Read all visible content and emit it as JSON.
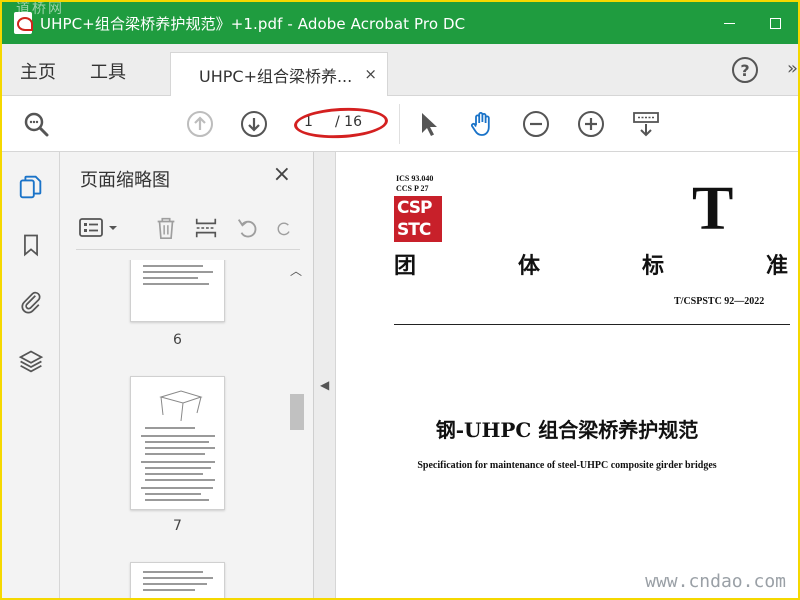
{
  "window": {
    "title": "UHPC+组合梁桥养护规范》+1.pdf - Adobe Acrobat Pro DC",
    "watermark_top": "道桥网"
  },
  "menu": {
    "home_label": "主页",
    "tools_label": "工具",
    "doc_tab_label": "UHPC+组合梁桥养...",
    "doc_tab_close": "×",
    "help_label": "?",
    "more_label": "»"
  },
  "toolbar": {
    "current_page": "1",
    "total_pages": "/ 16",
    "icons": [
      "search-icon",
      "page-up-icon",
      "page-down-icon",
      "select-arrow-icon",
      "hand-tool-icon",
      "zoom-out-icon",
      "zoom-in-icon",
      "keyboard-scroll-icon"
    ],
    "accent_color": "#1a73c8",
    "highlight_color": "#d42020"
  },
  "sidebar": {
    "icons": [
      "page-thumbnails-icon",
      "bookmarks-icon",
      "attachments-icon",
      "layers-icon"
    ]
  },
  "thumb_panel": {
    "title": "页面缩略图",
    "close_label": "×",
    "tools": [
      "options-menu-icon",
      "delete-icon",
      "insert-page-icon",
      "rotate-left-icon",
      "rotate-right-icon"
    ],
    "pages": [
      {
        "number": "6"
      },
      {
        "number": "7"
      }
    ]
  },
  "document": {
    "ics": "ICS  93.040",
    "ccs": "CCS  P  27",
    "logo_top": "CSP",
    "logo_bottom": "STC",
    "big_letter": "T",
    "group_standard_chars": [
      "团",
      "体",
      "标",
      "准"
    ],
    "standard_number": "T/CSPSTC  92—2022",
    "title_cn": "钢-UHPC 组合梁桥养护规范",
    "title_en": "Specification for maintenance of steel-UHPC composite girder bridges",
    "watermark": "www.cndao.com"
  },
  "colors": {
    "titlebar": "#1f9c3f",
    "border_frame": "#f5d800",
    "logo_red": "#c8202a"
  }
}
